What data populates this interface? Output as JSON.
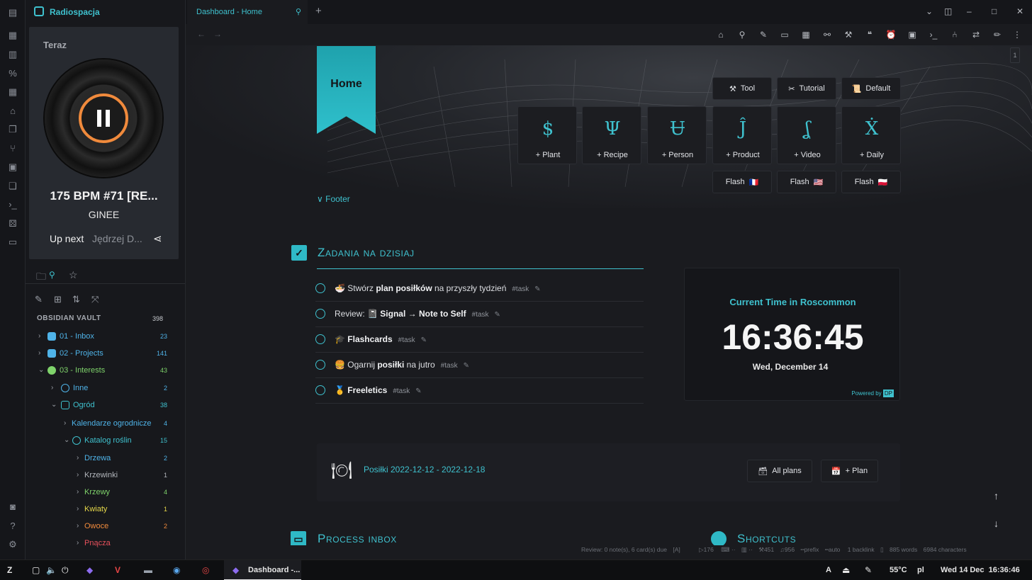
{
  "sidebar": {
    "title": "Radiospacja",
    "player": {
      "now_label": "Teraz",
      "track": "175 BPM #71 [RE...",
      "artist": "GINEE",
      "up_next_label": "Up next",
      "next_track": "Jędrzej D..."
    },
    "vault": {
      "label": "OBSIDIAN VAULT",
      "count": "398"
    },
    "tree": [
      {
        "label": "01 - Inbox",
        "count": "23",
        "color": "#4fb3e8"
      },
      {
        "label": "02 - Projects",
        "count": "141",
        "color": "#4fb3e8"
      },
      {
        "label": "03 - Interests",
        "count": "43",
        "color": "#7fd36b"
      },
      {
        "label": "Inne",
        "count": "2",
        "color": "#4fb3e8"
      },
      {
        "label": "Ogród",
        "count": "38",
        "color": "#3fc1ce"
      },
      {
        "label": "Kalendarze ogrodnicze",
        "count": "4",
        "color": "#4fb3e8"
      },
      {
        "label": "Katalog roślin",
        "count": "15",
        "color": "#3fc1ce"
      },
      {
        "label": "Drzewa",
        "count": "2",
        "color": "#4fb3e8"
      },
      {
        "label": "Krzewinki",
        "count": "1",
        "color": "#9da1a8"
      },
      {
        "label": "Krzewy",
        "count": "4",
        "color": "#7fd36b"
      },
      {
        "label": "Kwiaty",
        "count": "1",
        "color": "#e6d84a"
      },
      {
        "label": "Owoce",
        "count": "2",
        "color": "#f08a3c"
      },
      {
        "label": "Pnącza",
        "count": "",
        "color": "#e8515c"
      }
    ]
  },
  "tab": {
    "title": "Dashboard - Home"
  },
  "header": {
    "home_label": "Home",
    "buttons": {
      "tool": "Tool",
      "tutorial": "Tutorial",
      "default": "Default"
    },
    "cards": [
      {
        "label": "+ Plant",
        "glyph": "$"
      },
      {
        "label": "+ Recipe",
        "glyph": "Ψ"
      },
      {
        "label": "+ Person",
        "glyph": "Ʉ"
      },
      {
        "label": "+ Product",
        "glyph": "Ĵ"
      },
      {
        "label": "+ Video",
        "glyph": "ʆ"
      },
      {
        "label": "+ Daily",
        "glyph": "Ẋ"
      }
    ],
    "flash": [
      {
        "label": "Flash",
        "flag": "🇫🇷"
      },
      {
        "label": "Flash",
        "flag": "🇺🇸"
      },
      {
        "label": "Flash",
        "flag": "🇵🇱"
      }
    ],
    "footer_link": "Footer"
  },
  "tasks_section": {
    "title": "Zadania na dzisiaj",
    "tasks": [
      {
        "emoji": "🍜",
        "pre": "Stwórz ",
        "bold": "plan posiłków",
        "post": " na przyszły tydzień",
        "tag": "#task"
      },
      {
        "emoji": "",
        "pre": "Review: 📓 ",
        "bold": "Signal → Note to Self",
        "post": "",
        "tag": "#task"
      },
      {
        "emoji": "🎓",
        "pre": "",
        "bold": "Flashcards",
        "post": "",
        "tag": "#task"
      },
      {
        "emoji": "🍔",
        "pre": "Ogarnij ",
        "bold": "posiłki",
        "post": " na jutro",
        "tag": "#task"
      },
      {
        "emoji": "🥇",
        "pre": "",
        "bold": "Freeletics",
        "post": "",
        "tag": "#task"
      }
    ]
  },
  "clock": {
    "title": "Current Time in Roscommon",
    "time": "16:36:45",
    "date": "Wed, December 14",
    "powered": "Powered by"
  },
  "meals": {
    "link": "Posiłki 2022-12-12 - 2022-12-18",
    "all_plans": "All plans",
    "plan": "+ Plan"
  },
  "process_section": {
    "title": "Process inbox"
  },
  "shortcuts_section": {
    "title": "Shortcuts"
  },
  "status_bar": {
    "review": "Review: 0 note(s), 6 card(s) due",
    "n176": "176",
    "n451": "451",
    "n956": "956",
    "prefix": "prefix",
    "auto": "auto",
    "backlink": "1 backlink",
    "words": "885 words",
    "chars": "6984 characters"
  },
  "right_gutter": "1",
  "taskbar": {
    "active_window": "Dashboard -...",
    "lang_a": "A",
    "temp": "55°C",
    "lang": "pl",
    "datetime": "Wed 14 Dec  16:36:46"
  },
  "colors": {
    "accent": "#3fc1ce",
    "vinyl_ring": "#f08a3c",
    "background": "#1a1b1f"
  }
}
